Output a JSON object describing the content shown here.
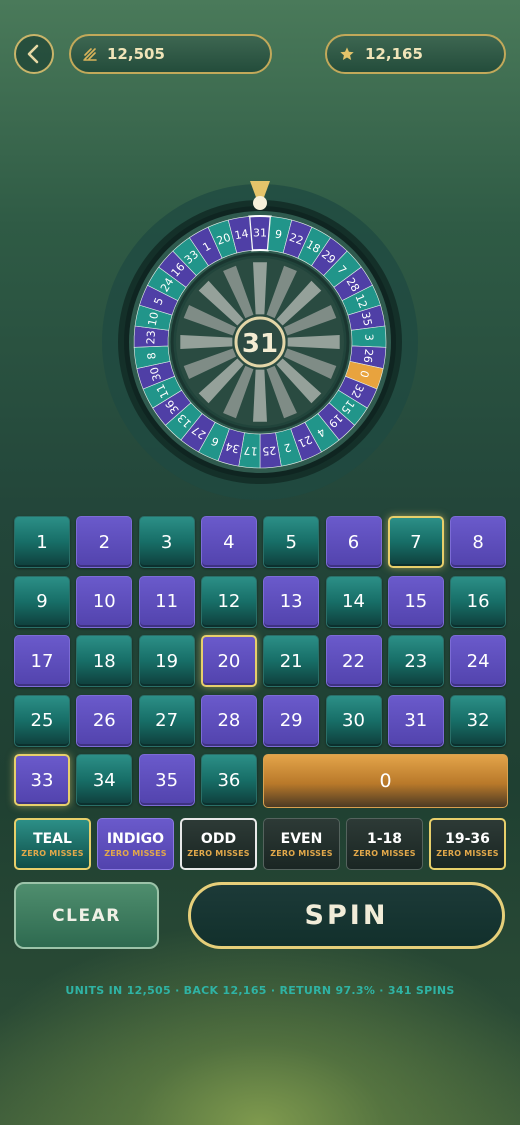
{
  "header": {
    "back_icon": "chevron-left-icon",
    "units_icon": "units-icon",
    "units_value": "12,505",
    "back_stars_icon": "star-icon",
    "back_value": "12,165"
  },
  "wheel": {
    "result": "31",
    "pockets": [
      "31",
      "9",
      "22",
      "18",
      "29",
      "7",
      "28",
      "12",
      "35",
      "3",
      "26",
      "0",
      "32",
      "15",
      "19",
      "4",
      "21",
      "2",
      "25",
      "17",
      "34",
      "6",
      "27",
      "13",
      "36",
      "11",
      "30",
      "8",
      "23",
      "10",
      "5",
      "24",
      "16",
      "33",
      "1",
      "20",
      "14"
    ],
    "zero_color": "#e8a33e",
    "teal_color": "#21958a",
    "indigo_color": "#4f3fa6",
    "pointer_color": "#e4c46a"
  },
  "board": {
    "cells": [
      {
        "n": "1",
        "c": "teal"
      },
      {
        "n": "2",
        "c": "indigo"
      },
      {
        "n": "3",
        "c": "teal"
      },
      {
        "n": "4",
        "c": "indigo"
      },
      {
        "n": "5",
        "c": "teal"
      },
      {
        "n": "6",
        "c": "indigo"
      },
      {
        "n": "7",
        "c": "teal",
        "hot": true
      },
      {
        "n": "8",
        "c": "indigo"
      },
      {
        "n": "9",
        "c": "teal"
      },
      {
        "n": "10",
        "c": "indigo"
      },
      {
        "n": "11",
        "c": "indigo"
      },
      {
        "n": "12",
        "c": "teal"
      },
      {
        "n": "13",
        "c": "indigo"
      },
      {
        "n": "14",
        "c": "teal"
      },
      {
        "n": "15",
        "c": "indigo"
      },
      {
        "n": "16",
        "c": "teal"
      },
      {
        "n": "17",
        "c": "indigo"
      },
      {
        "n": "18",
        "c": "teal"
      },
      {
        "n": "19",
        "c": "teal"
      },
      {
        "n": "20",
        "c": "indigo",
        "hot": true
      },
      {
        "n": "21",
        "c": "teal"
      },
      {
        "n": "22",
        "c": "indigo"
      },
      {
        "n": "23",
        "c": "teal"
      },
      {
        "n": "24",
        "c": "indigo"
      },
      {
        "n": "25",
        "c": "teal"
      },
      {
        "n": "26",
        "c": "indigo"
      },
      {
        "n": "27",
        "c": "teal"
      },
      {
        "n": "28",
        "c": "indigo"
      },
      {
        "n": "29",
        "c": "indigo"
      },
      {
        "n": "30",
        "c": "teal"
      },
      {
        "n": "31",
        "c": "indigo"
      },
      {
        "n": "32",
        "c": "teal"
      },
      {
        "n": "33",
        "c": "indigo",
        "hot": true
      },
      {
        "n": "34",
        "c": "teal"
      },
      {
        "n": "35",
        "c": "indigo"
      },
      {
        "n": "36",
        "c": "teal"
      }
    ],
    "zero_label": "0"
  },
  "bets": [
    {
      "label": "TEAL",
      "sub": "ZERO MISSES",
      "style": "teal-b"
    },
    {
      "label": "INDIGO",
      "sub": "ZERO MISSES",
      "style": "indigo-b"
    },
    {
      "label": "ODD",
      "sub": "ZERO MISSES",
      "style": "odd-b"
    },
    {
      "label": "EVEN",
      "sub": "ZERO MISSES",
      "style": "dark-b"
    },
    {
      "label": "1-18",
      "sub": "ZERO MISSES",
      "style": "dark-b"
    },
    {
      "label": "19-36",
      "sub": "ZERO MISSES",
      "style": "gold-b"
    }
  ],
  "actions": {
    "clear_label": "CLEAR",
    "spin_label": "SPIN"
  },
  "footer": {
    "text": "UNITS IN 12,505 · BACK 12,165 · RETURN 97.3% · 341 SPINS"
  }
}
